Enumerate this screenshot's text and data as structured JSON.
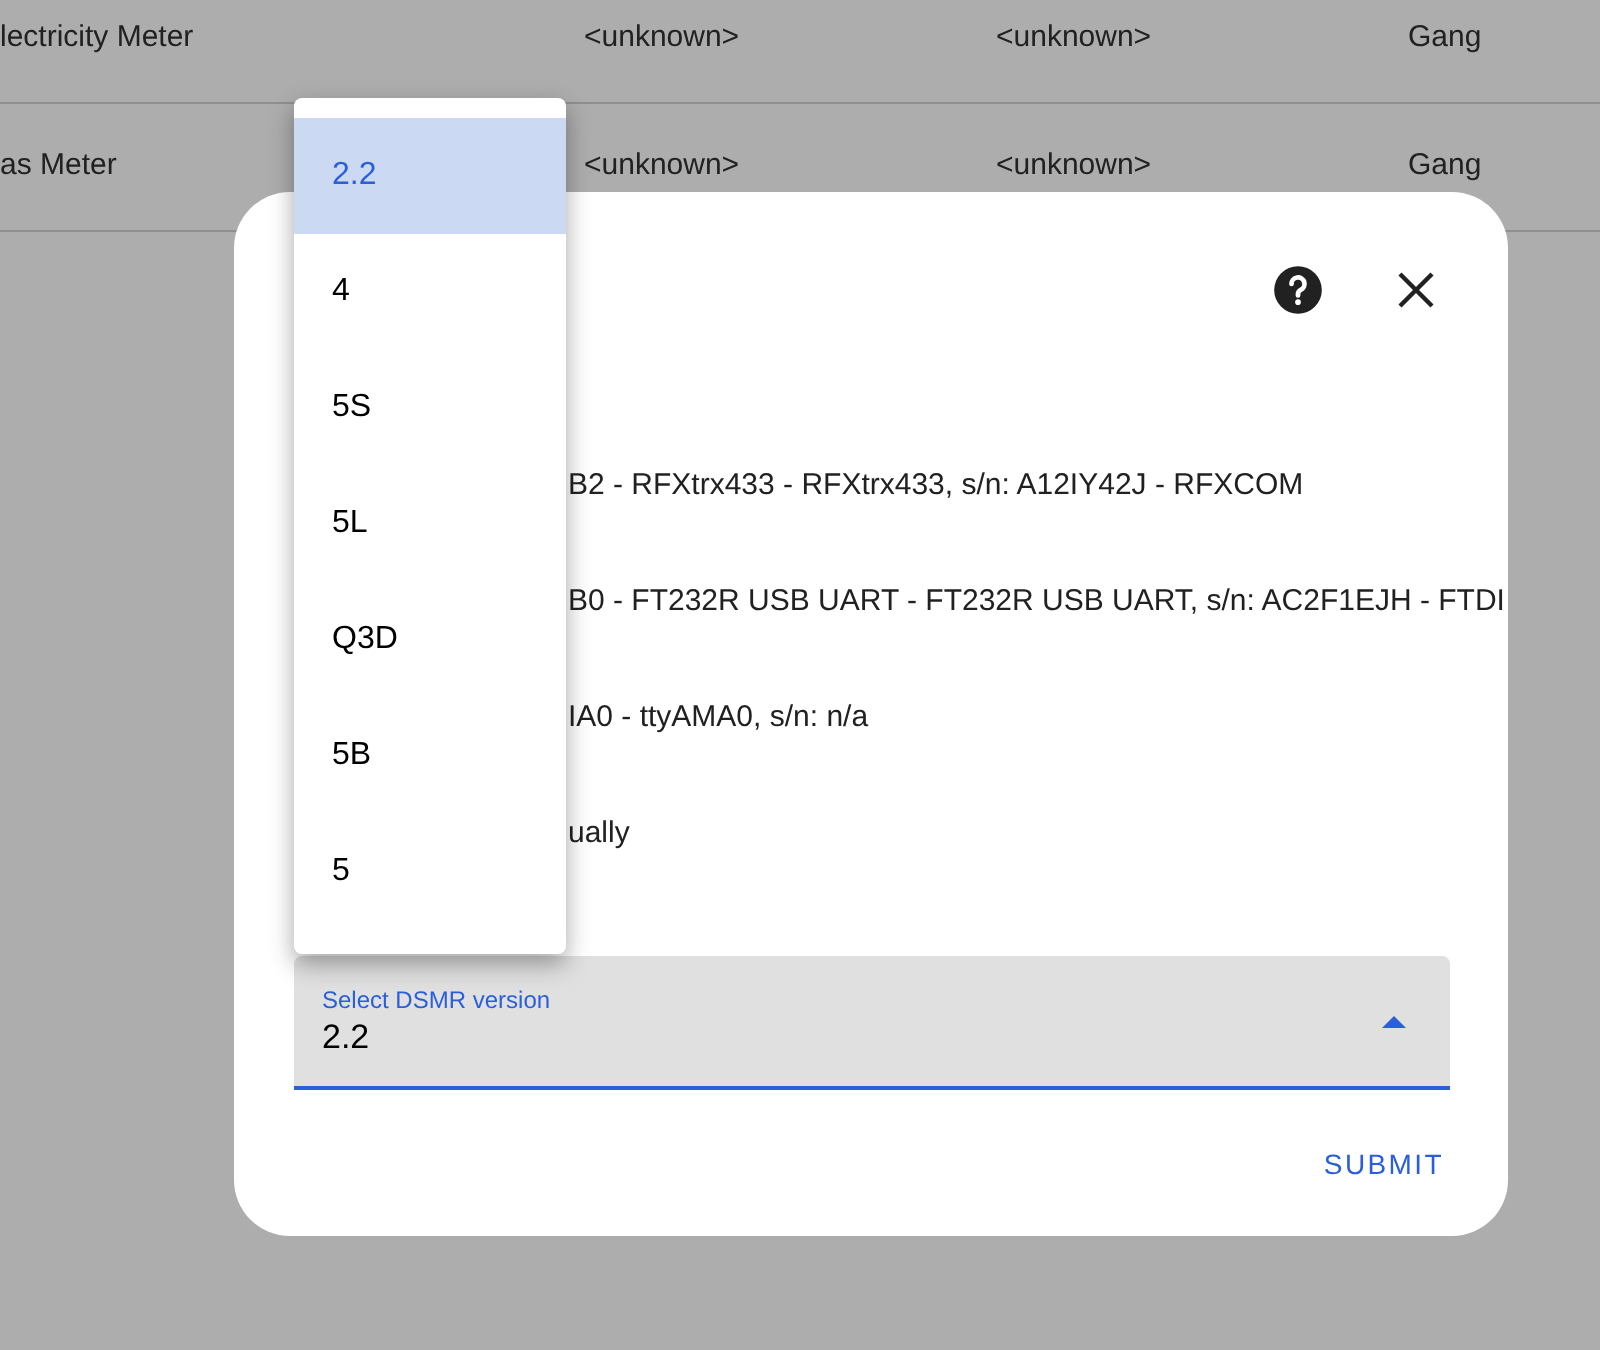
{
  "table": {
    "rows": [
      {
        "column_1": "lectricity Meter",
        "column_2": "<unknown>",
        "column_3": "<unknown>",
        "column_4": "Gang"
      },
      {
        "column_1": "as Meter",
        "column_2": "<unknown>",
        "column_3": "<unknown>",
        "column_4": "Gang"
      }
    ]
  },
  "dialog": {
    "options": [
      "B2 - RFXtrx433 - RFXtrx433, s/n: A12IY42J - RFXCOM",
      "B0 - FT232R USB UART - FT232R USB UART, s/n: AC2F1EJH - FTDI",
      "IA0 - ttyAMA0, s/n: n/a",
      "ually"
    ],
    "select": {
      "label": "Select DSMR version",
      "value": "2.2",
      "expanded": true
    },
    "submit": "SUBMIT"
  },
  "menu": {
    "items": [
      {
        "label": "2.2",
        "selected": true
      },
      {
        "label": "4",
        "selected": false
      },
      {
        "label": "5S",
        "selected": false
      },
      {
        "label": "5L",
        "selected": false
      },
      {
        "label": "Q3D",
        "selected": false
      },
      {
        "label": "5B",
        "selected": false
      },
      {
        "label": "5",
        "selected": false
      }
    ]
  }
}
